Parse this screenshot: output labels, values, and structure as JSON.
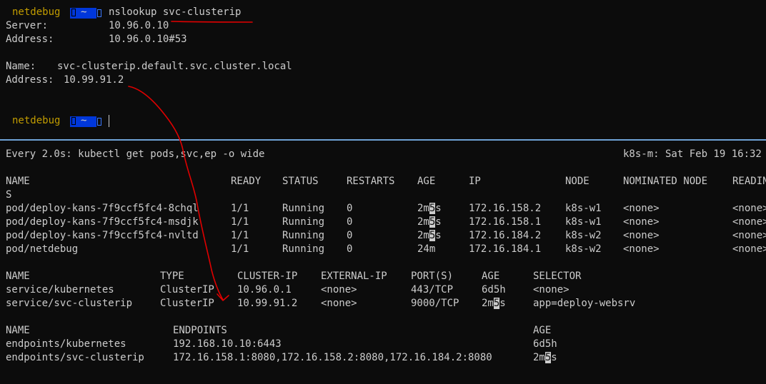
{
  "top": {
    "prompt1": {
      "host": "netdebug",
      "dir": "~",
      "command": "nslookup svc-clusterip"
    },
    "server": {
      "label": "Server:",
      "value": "10.96.0.10"
    },
    "server_address": {
      "label": "Address:",
      "value": "10.96.0.10#53"
    },
    "name": {
      "label": "Name:",
      "value": "svc-clusterip.default.svc.cluster.local"
    },
    "answer": {
      "label": "Address:",
      "value": "10.99.91.2"
    },
    "prompt2": {
      "host": "netdebug",
      "dir": "~"
    }
  },
  "watch": {
    "header_left": "Every 2.0s: kubectl get pods,svc,ep -o wide",
    "header_right": "k8s-m: Sat Feb 19 16:32",
    "pods": {
      "headers": [
        "NAME",
        "READY",
        "STATUS",
        "RESTARTS",
        "AGE",
        "IP",
        "NODE",
        "NOMINATED NODE",
        "READINES"
      ],
      "wrap": "S",
      "rows": [
        {
          "name": "pod/deploy-kans-7f9ccf5fc4-8chql",
          "ready": "1/1",
          "status": "Running",
          "restarts": "0",
          "age_a": "2m",
          "age_b": "5",
          "age_c": "s",
          "ip": "172.16.158.2",
          "node": "k8s-w1",
          "nominated": "<none>",
          "readiness": "<none>"
        },
        {
          "name": "pod/deploy-kans-7f9ccf5fc4-msdjk",
          "ready": "1/1",
          "status": "Running",
          "restarts": "0",
          "age_a": "2m",
          "age_b": "5",
          "age_c": "s",
          "ip": "172.16.158.1",
          "node": "k8s-w1",
          "nominated": "<none>",
          "readiness": "<none>"
        },
        {
          "name": "pod/deploy-kans-7f9ccf5fc4-nvltd",
          "ready": "1/1",
          "status": "Running",
          "restarts": "0",
          "age_a": "2m",
          "age_b": "5",
          "age_c": "s",
          "ip": "172.16.184.2",
          "node": "k8s-w2",
          "nominated": "<none>",
          "readiness": "<none>"
        },
        {
          "name": "pod/netdebug",
          "ready": "1/1",
          "status": "Running",
          "restarts": "0",
          "age": "24m",
          "ip": "172.16.184.1",
          "node": "k8s-w2",
          "nominated": "<none>",
          "readiness": "<none>"
        }
      ]
    },
    "services": {
      "headers": [
        "NAME",
        "TYPE",
        "CLUSTER-IP",
        "EXTERNAL-IP",
        "PORT(S)",
        "AGE",
        "SELECTOR"
      ],
      "rows": [
        {
          "name": "service/kubernetes",
          "type": "ClusterIP",
          "cluster_ip": "10.96.0.1",
          "external_ip": "<none>",
          "ports": "443/TCP",
          "age": "6d5h",
          "selector": "<none>"
        },
        {
          "name": "service/svc-clusterip",
          "type": "ClusterIP",
          "cluster_ip": "10.99.91.2",
          "external_ip": "<none>",
          "ports": "9000/TCP",
          "age_a": "2m",
          "age_b": "5",
          "age_c": "s",
          "selector": "app=deploy-websrv"
        }
      ]
    },
    "endpoints": {
      "headers": [
        "NAME",
        "ENDPOINTS",
        "AGE"
      ],
      "rows": [
        {
          "name": "endpoints/kubernetes",
          "endpoints": "192.168.10.10:6443",
          "age": "6d5h"
        },
        {
          "name": "endpoints/svc-clusterip",
          "endpoints": "172.16.158.1:8080,172.16.158.2:8080,172.16.184.2:8080",
          "age_a": "2m",
          "age_b": "5",
          "age_c": "s"
        }
      ]
    }
  },
  "colors": {
    "background": "#0c0c0c",
    "text": "#cccccc",
    "prompt_host": "#c19c00",
    "prompt_segment": "#0037da",
    "pane_divider": "#6fa3d6",
    "annotation": "#e00000"
  }
}
